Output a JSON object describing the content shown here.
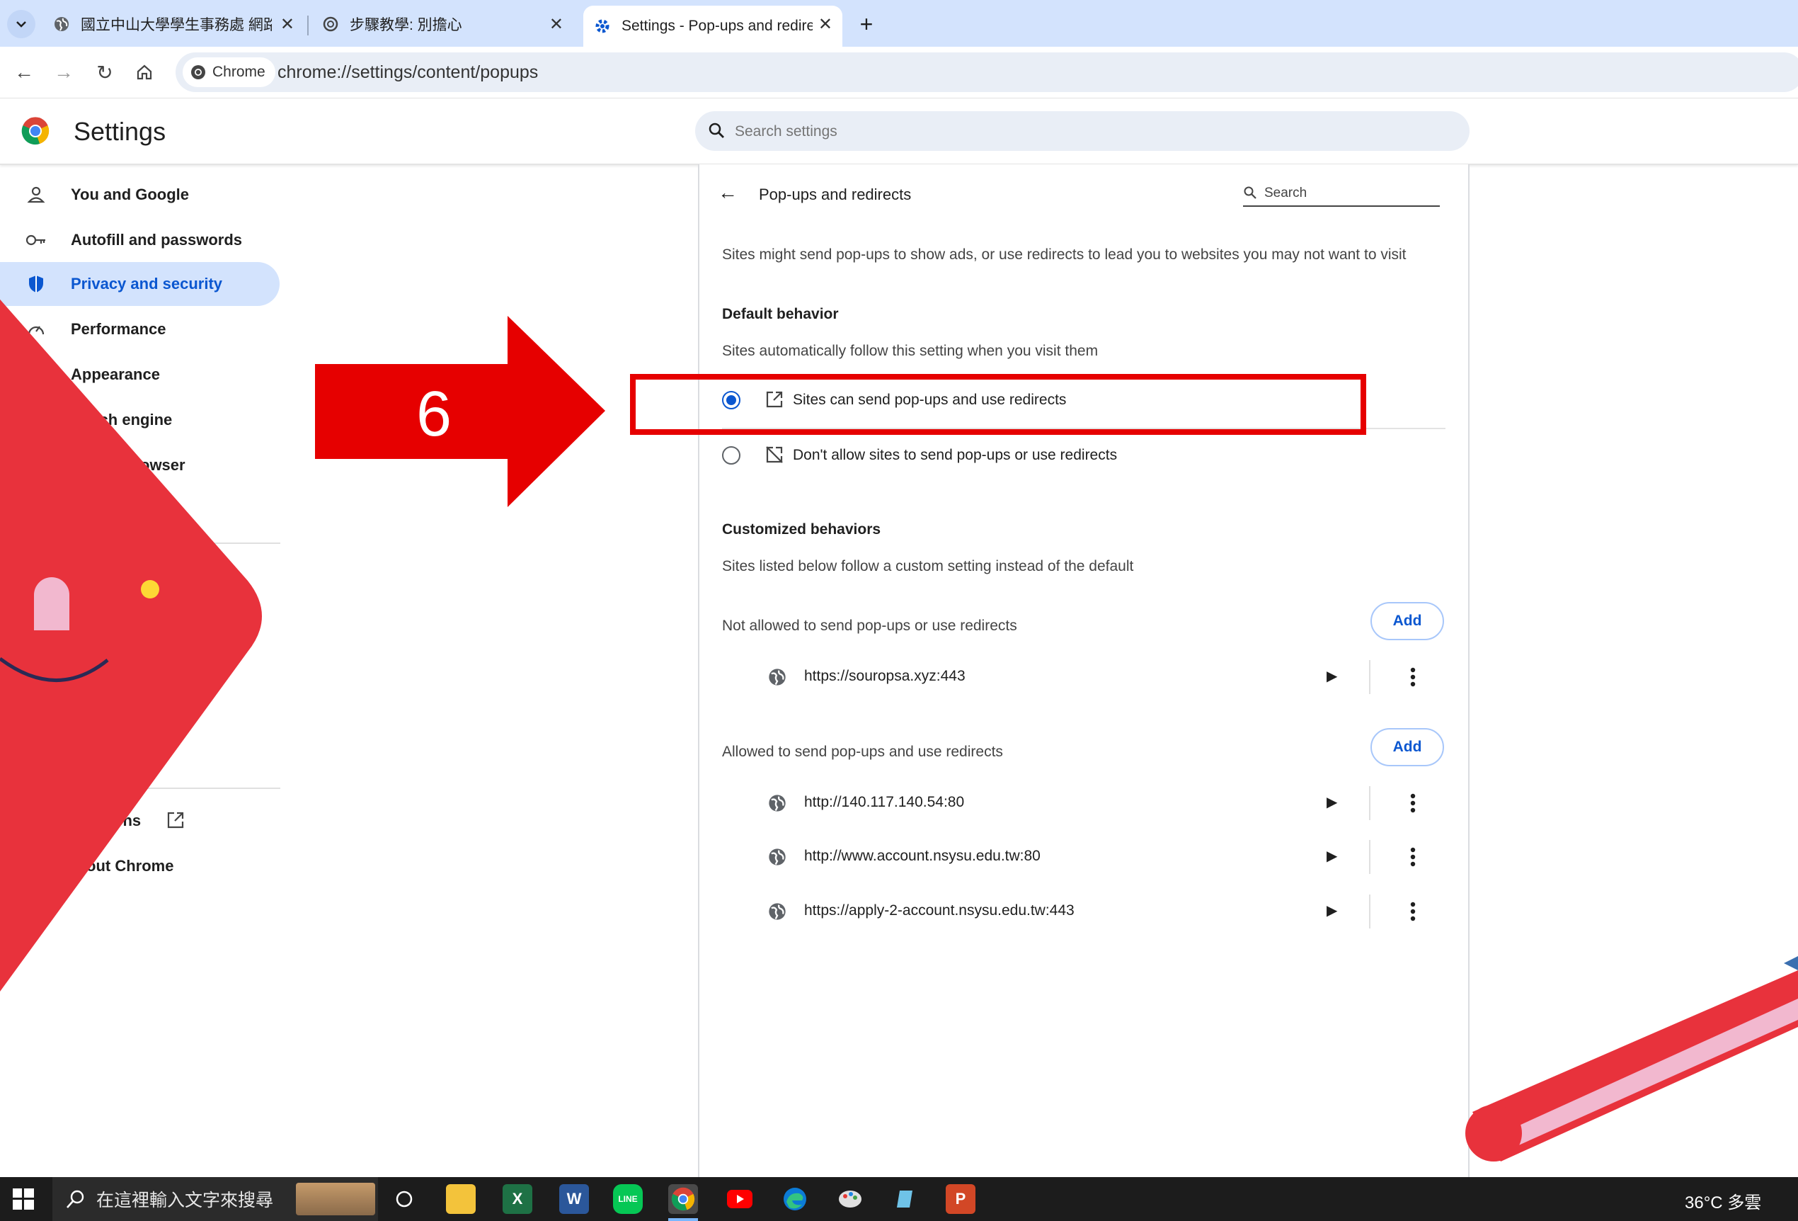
{
  "tabs": [
    {
      "title": "國立中山大學學生事務處 網路申",
      "icon": "globe-icon"
    },
    {
      "title": "步驟教學: 別擔心",
      "icon": "openai-icon"
    },
    {
      "title": "Settings - Pop-ups and redirec",
      "icon": "gear-icon"
    }
  ],
  "toolbar": {
    "chip_label": "Chrome",
    "url": "chrome://settings/content/popups"
  },
  "settings": {
    "title": "Settings",
    "search_placeholder": "Search settings"
  },
  "sidebar": {
    "items": [
      {
        "label": "You and Google"
      },
      {
        "label": "Autofill and passwords"
      },
      {
        "label": "Privacy and security"
      },
      {
        "label": "Performance"
      },
      {
        "label": "Appearance"
      },
      {
        "label": "rch engine"
      },
      {
        "label": "browser"
      },
      {
        "label": "ons"
      },
      {
        "label": "out Chrome"
      }
    ]
  },
  "main": {
    "page_title": "Pop-ups and redirects",
    "search_label": "Search",
    "description": "Sites might send pop-ups to show ads, or use redirects to lead you to websites you may not want to visit",
    "default_heading": "Default behavior",
    "default_sub": "Sites automatically follow this setting when you visit them",
    "option_allow": "Sites can send pop-ups and use redirects",
    "option_block": "Don't allow sites to send pop-ups or use redirects",
    "selected_option": "allow",
    "custom_heading": "Customized behaviors",
    "custom_sub": "Sites listed below follow a custom setting instead of the default",
    "blocked_label": "Not allowed to send pop-ups or use redirects",
    "allowed_label": "Allowed to send pop-ups and use redirects",
    "add_label": "Add",
    "blocked_sites": [
      "https://souropsa.xyz:443"
    ],
    "allowed_sites": [
      "http://140.117.140.54:80",
      "http://www.account.nsysu.edu.tw:80",
      "https://apply-2-account.nsysu.edu.tw:443"
    ]
  },
  "annotation": {
    "step_number": "6",
    "highlight_color": "#e60000"
  },
  "taskbar": {
    "search_placeholder": "在這裡輸入文字來搜尋",
    "weather": "36°C 多雲",
    "apps": [
      "task-view-icon",
      "file-explorer-icon",
      "excel-icon",
      "word-icon",
      "line-icon",
      "chrome-icon",
      "youtube-icon",
      "edge-icon",
      "paint-icon",
      "notepad-icon",
      "powerpoint-icon"
    ]
  },
  "colors": {
    "accent": "#0b57d0",
    "tabstrip": "#d3e3fd",
    "active_nav": "#d3e3fd",
    "decor_red": "#e8323c",
    "decor_pink": "#f2b8cf"
  }
}
